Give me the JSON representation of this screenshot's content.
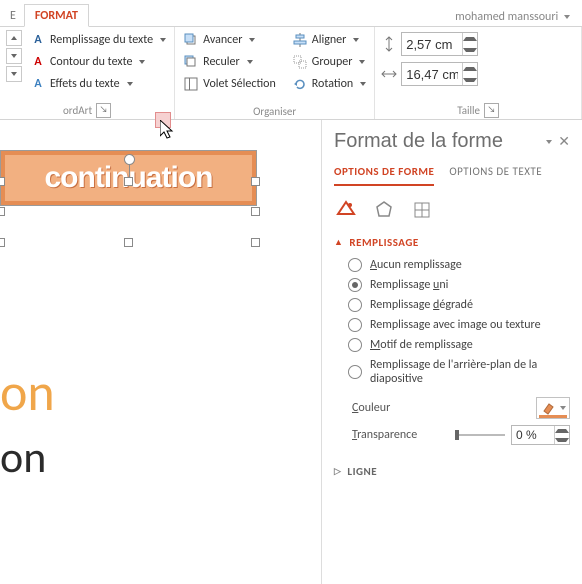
{
  "tabs": {
    "edge": "E",
    "active": "FORMAT"
  },
  "user": "mohamed manssouri",
  "ribbon": {
    "wordart": {
      "label": "ordArt",
      "fill": "Remplissage du texte",
      "outline": "Contour du texte",
      "effects": "Effets du texte"
    },
    "arrange": {
      "label": "Organiser",
      "forward": "Avancer",
      "backward": "Reculer",
      "selection": "Volet Sélection",
      "align": "Aligner",
      "group": "Grouper",
      "rotate": "Rotation"
    },
    "size": {
      "label": "Taille",
      "height": "2,57 cm",
      "width": "16,47 cm"
    }
  },
  "slide": {
    "wordart_text": "continuation",
    "text1": "on",
    "text2": "on"
  },
  "pane": {
    "title": "Format de la forme",
    "tab1": "OPTIONS DE FORME",
    "tab2": "OPTIONS DE TEXTE",
    "sec_fill": "REMPLISSAGE",
    "sec_line": "LIGNE",
    "fill_none": "Aucun remplissage",
    "fill_solid": "Remplissage uni",
    "fill_grad": "Remplissage dégradé",
    "fill_pic": "Remplissage avec image ou texture",
    "fill_pattern": "Motif de remplissage",
    "fill_slidebg": "Remplissage de l'arrière-plan de la diapositive",
    "color_label": "Couleur",
    "transp_label": "Transparence",
    "transp_value": "0 %"
  }
}
